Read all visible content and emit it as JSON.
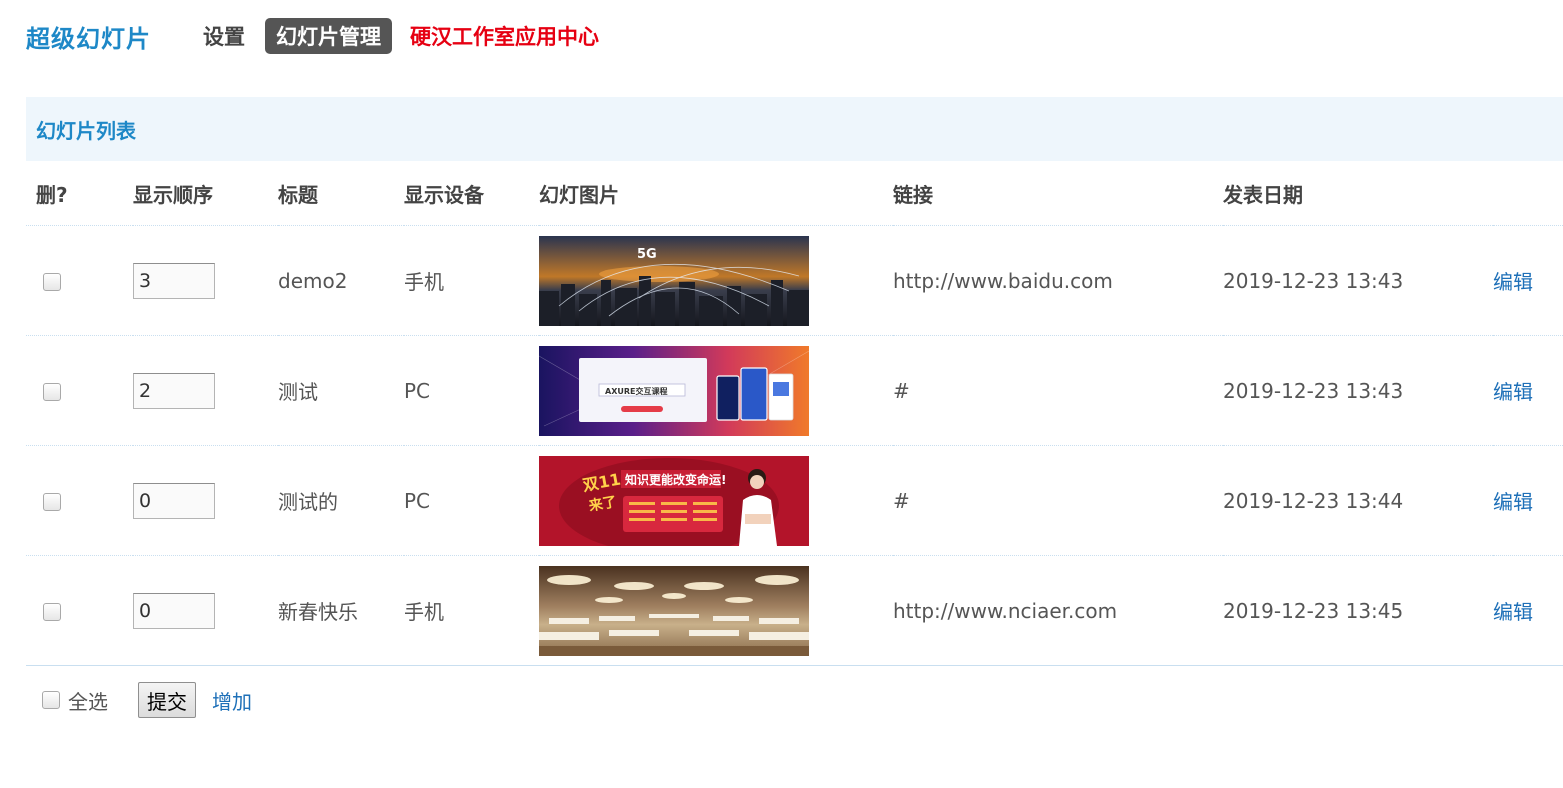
{
  "nav": {
    "title": "超级幻灯片",
    "settings": "设置",
    "active": "幻灯片管理",
    "app_center": "硬汉工作室应用中心"
  },
  "panel": {
    "title": "幻灯片列表"
  },
  "table": {
    "headers": [
      "删?",
      "显示顺序",
      "标题",
      "显示设备",
      "幻灯图片",
      "链接",
      "发表日期"
    ],
    "rows": [
      {
        "order": "3",
        "title": "demo2",
        "device": "手机",
        "image": "5G-city-banner",
        "link": "http://www.baidu.com",
        "date": "2019-12-23 13:43",
        "edit": "编辑"
      },
      {
        "order": "2",
        "title": "测试",
        "device": "PC",
        "image": "axure-course-banner",
        "link": "#",
        "date": "2019-12-23 13:43",
        "edit": "编辑"
      },
      {
        "order": "0",
        "title": "测试的",
        "device": "PC",
        "image": "double11-knowledge-banner",
        "link": "#",
        "date": "2019-12-23 13:44",
        "edit": "编辑"
      },
      {
        "order": "0",
        "title": "新春快乐",
        "device": "手机",
        "image": "banquet-hall-banner",
        "link": "http://www.nciaer.com",
        "date": "2019-12-23 13:45",
        "edit": "编辑"
      }
    ]
  },
  "footer": {
    "select_all": "全选",
    "submit": "提交",
    "add": "增加"
  },
  "colors": {
    "accent": "#1e88c7",
    "link": "#1e70b8",
    "red": "#e60012",
    "header_bg": "#eef6fc"
  }
}
